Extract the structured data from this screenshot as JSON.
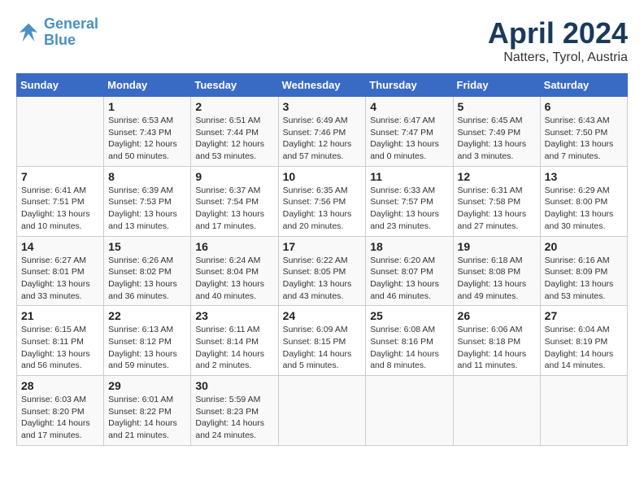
{
  "logo": {
    "line1": "General",
    "line2": "Blue"
  },
  "title": "April 2024",
  "location": "Natters, Tyrol, Austria",
  "days_of_week": [
    "Sunday",
    "Monday",
    "Tuesday",
    "Wednesday",
    "Thursday",
    "Friday",
    "Saturday"
  ],
  "weeks": [
    [
      {
        "num": "",
        "info": ""
      },
      {
        "num": "1",
        "info": "Sunrise: 6:53 AM\nSunset: 7:43 PM\nDaylight: 12 hours\nand 50 minutes."
      },
      {
        "num": "2",
        "info": "Sunrise: 6:51 AM\nSunset: 7:44 PM\nDaylight: 12 hours\nand 53 minutes."
      },
      {
        "num": "3",
        "info": "Sunrise: 6:49 AM\nSunset: 7:46 PM\nDaylight: 12 hours\nand 57 minutes."
      },
      {
        "num": "4",
        "info": "Sunrise: 6:47 AM\nSunset: 7:47 PM\nDaylight: 13 hours\nand 0 minutes."
      },
      {
        "num": "5",
        "info": "Sunrise: 6:45 AM\nSunset: 7:49 PM\nDaylight: 13 hours\nand 3 minutes."
      },
      {
        "num": "6",
        "info": "Sunrise: 6:43 AM\nSunset: 7:50 PM\nDaylight: 13 hours\nand 7 minutes."
      }
    ],
    [
      {
        "num": "7",
        "info": "Sunrise: 6:41 AM\nSunset: 7:51 PM\nDaylight: 13 hours\nand 10 minutes."
      },
      {
        "num": "8",
        "info": "Sunrise: 6:39 AM\nSunset: 7:53 PM\nDaylight: 13 hours\nand 13 minutes."
      },
      {
        "num": "9",
        "info": "Sunrise: 6:37 AM\nSunset: 7:54 PM\nDaylight: 13 hours\nand 17 minutes."
      },
      {
        "num": "10",
        "info": "Sunrise: 6:35 AM\nSunset: 7:56 PM\nDaylight: 13 hours\nand 20 minutes."
      },
      {
        "num": "11",
        "info": "Sunrise: 6:33 AM\nSunset: 7:57 PM\nDaylight: 13 hours\nand 23 minutes."
      },
      {
        "num": "12",
        "info": "Sunrise: 6:31 AM\nSunset: 7:58 PM\nDaylight: 13 hours\nand 27 minutes."
      },
      {
        "num": "13",
        "info": "Sunrise: 6:29 AM\nSunset: 8:00 PM\nDaylight: 13 hours\nand 30 minutes."
      }
    ],
    [
      {
        "num": "14",
        "info": "Sunrise: 6:27 AM\nSunset: 8:01 PM\nDaylight: 13 hours\nand 33 minutes."
      },
      {
        "num": "15",
        "info": "Sunrise: 6:26 AM\nSunset: 8:02 PM\nDaylight: 13 hours\nand 36 minutes."
      },
      {
        "num": "16",
        "info": "Sunrise: 6:24 AM\nSunset: 8:04 PM\nDaylight: 13 hours\nand 40 minutes."
      },
      {
        "num": "17",
        "info": "Sunrise: 6:22 AM\nSunset: 8:05 PM\nDaylight: 13 hours\nand 43 minutes."
      },
      {
        "num": "18",
        "info": "Sunrise: 6:20 AM\nSunset: 8:07 PM\nDaylight: 13 hours\nand 46 minutes."
      },
      {
        "num": "19",
        "info": "Sunrise: 6:18 AM\nSunset: 8:08 PM\nDaylight: 13 hours\nand 49 minutes."
      },
      {
        "num": "20",
        "info": "Sunrise: 6:16 AM\nSunset: 8:09 PM\nDaylight: 13 hours\nand 53 minutes."
      }
    ],
    [
      {
        "num": "21",
        "info": "Sunrise: 6:15 AM\nSunset: 8:11 PM\nDaylight: 13 hours\nand 56 minutes."
      },
      {
        "num": "22",
        "info": "Sunrise: 6:13 AM\nSunset: 8:12 PM\nDaylight: 13 hours\nand 59 minutes."
      },
      {
        "num": "23",
        "info": "Sunrise: 6:11 AM\nSunset: 8:14 PM\nDaylight: 14 hours\nand 2 minutes."
      },
      {
        "num": "24",
        "info": "Sunrise: 6:09 AM\nSunset: 8:15 PM\nDaylight: 14 hours\nand 5 minutes."
      },
      {
        "num": "25",
        "info": "Sunrise: 6:08 AM\nSunset: 8:16 PM\nDaylight: 14 hours\nand 8 minutes."
      },
      {
        "num": "26",
        "info": "Sunrise: 6:06 AM\nSunset: 8:18 PM\nDaylight: 14 hours\nand 11 minutes."
      },
      {
        "num": "27",
        "info": "Sunrise: 6:04 AM\nSunset: 8:19 PM\nDaylight: 14 hours\nand 14 minutes."
      }
    ],
    [
      {
        "num": "28",
        "info": "Sunrise: 6:03 AM\nSunset: 8:20 PM\nDaylight: 14 hours\nand 17 minutes."
      },
      {
        "num": "29",
        "info": "Sunrise: 6:01 AM\nSunset: 8:22 PM\nDaylight: 14 hours\nand 21 minutes."
      },
      {
        "num": "30",
        "info": "Sunrise: 5:59 AM\nSunset: 8:23 PM\nDaylight: 14 hours\nand 24 minutes."
      },
      {
        "num": "",
        "info": ""
      },
      {
        "num": "",
        "info": ""
      },
      {
        "num": "",
        "info": ""
      },
      {
        "num": "",
        "info": ""
      }
    ]
  ]
}
